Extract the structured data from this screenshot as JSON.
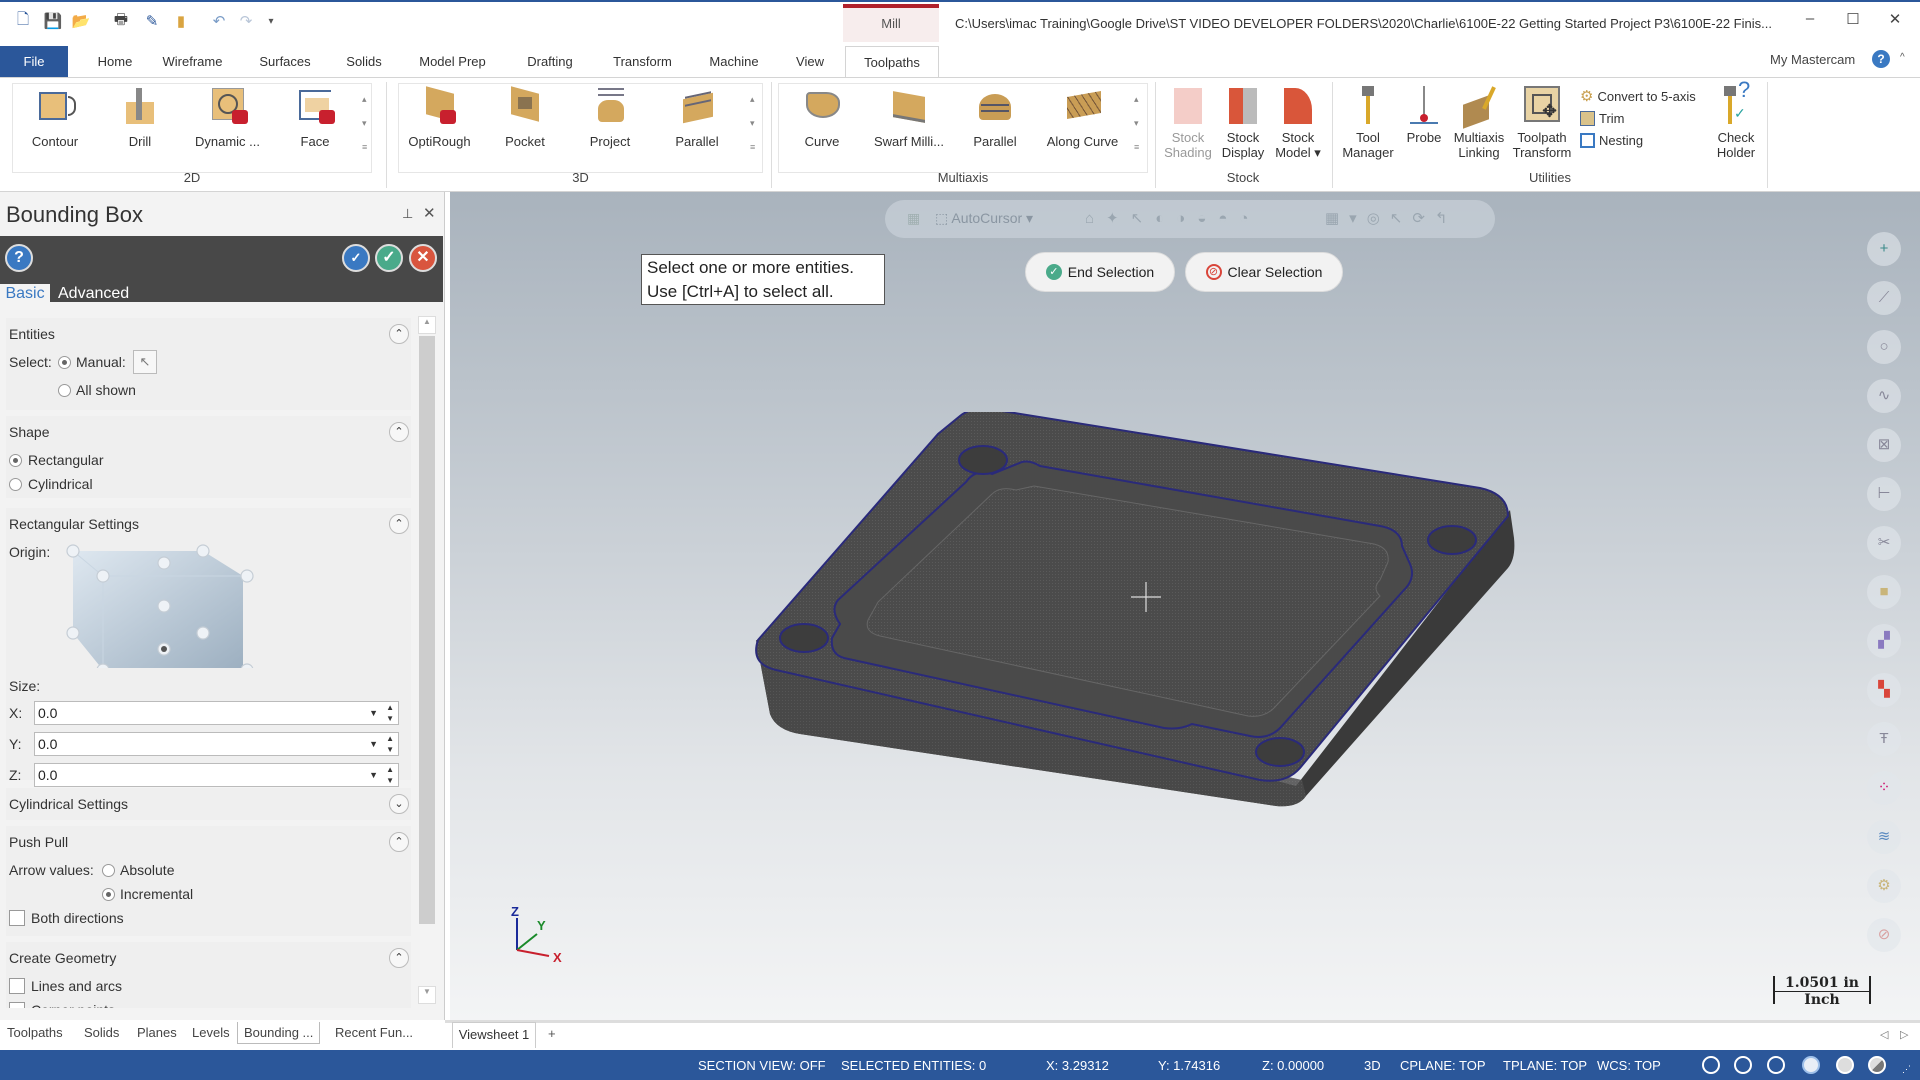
{
  "titlebar": {
    "quick_access": [
      "new-file-icon",
      "save-icon",
      "open-folder-icon",
      "print-icon",
      "save-as-icon",
      "file-manager-icon",
      "undo-icon",
      "redo-icon",
      "customize-icon"
    ],
    "context_tab": "Mill",
    "path": "C:\\Users\\imac Training\\Google Drive\\ST VIDEO DEVELOPER FOLDERS\\2020\\Charlie\\6100E-22 Getting Started Project P3\\6100E-22 Finis...",
    "window_controls": {
      "minimize": "–",
      "maximize": "☐",
      "close": "✕"
    }
  },
  "ribbon_tabs": [
    "File",
    "Home",
    "Wireframe",
    "Surfaces",
    "Solids",
    "Model Prep",
    "Drafting",
    "Transform",
    "Machine",
    "View",
    "Toolpaths"
  ],
  "active_ribbon_tab": "Toolpaths",
  "my_mastercam": "My Mastercam",
  "ribbon": {
    "groups": {
      "g2d": {
        "label": "2D",
        "buttons": [
          "Contour",
          "Drill",
          "Dynamic ...",
          "Face"
        ]
      },
      "g3d": {
        "label": "3D",
        "buttons": [
          "OptiRough",
          "Pocket",
          "Project",
          "Parallel"
        ]
      },
      "multiaxis": {
        "label": "Multiaxis",
        "buttons": [
          "Curve",
          "Swarf Milli...",
          "Parallel",
          "Along Curve"
        ]
      },
      "stock": {
        "label": "Stock",
        "buttons": [
          [
            "Stock",
            "Shading"
          ],
          [
            "Stock",
            "Display"
          ],
          [
            "Stock",
            "Model ▾"
          ]
        ]
      },
      "utilities": {
        "label": "Utilities",
        "buttons": [
          [
            "Tool",
            "Manager"
          ],
          [
            "Probe",
            ""
          ],
          [
            "Multiaxis",
            "Linking"
          ],
          [
            "Toolpath",
            "Transform"
          ]
        ],
        "small": [
          "Convert to 5-axis",
          "Trim",
          "Nesting"
        ],
        "check": [
          "Check",
          "Holder"
        ]
      }
    }
  },
  "panel": {
    "title": "Bounding Box",
    "tabs": {
      "basic": "Basic",
      "advanced": "Advanced"
    },
    "entities": {
      "header": "Entities",
      "select_label": "Select:",
      "manual": "Manual:",
      "all_shown": "All shown",
      "selected": "manual"
    },
    "shape": {
      "header": "Shape",
      "rectangular": "Rectangular",
      "cylindrical": "Cylindrical",
      "selected": "rectangular"
    },
    "rect_settings": {
      "header": "Rectangular Settings",
      "origin_label": "Origin:",
      "size_label": "Size:",
      "x_label": "X:",
      "y_label": "Y:",
      "z_label": "Z:",
      "x": "0.0",
      "y": "0.0",
      "z": "0.0"
    },
    "cyl_settings": {
      "header": "Cylindrical Settings"
    },
    "push_pull": {
      "header": "Push Pull",
      "arrow_label": "Arrow values:",
      "absolute": "Absolute",
      "incremental": "Incremental",
      "selected": "incremental",
      "both_directions": "Both directions",
      "both_checked": false
    },
    "create_geometry": {
      "header": "Create Geometry",
      "lines_arcs": "Lines and arcs",
      "corner_points": "Corner points"
    }
  },
  "bottom_tabs": [
    "Toolpaths",
    "Solids",
    "Planes",
    "Levels",
    "Bounding ...",
    "Recent Fun..."
  ],
  "active_bottom_tab": "Bounding ...",
  "viewsheet": {
    "tab": "Viewsheet 1",
    "add": "+"
  },
  "viewport": {
    "selection_toolbar": {
      "autocursor": "AutoCursor"
    },
    "prompt": [
      "Select one or more entities.",
      "Use [Ctrl+A] to select all."
    ],
    "end_selection": "End Selection",
    "clear_selection": "Clear Selection",
    "axes": {
      "x": "X",
      "y": "Y",
      "z": "Z"
    },
    "scale": {
      "value": "1.0501 in",
      "unit": "Inch"
    }
  },
  "statusbar": {
    "section_view": "SECTION VIEW: OFF",
    "selected_entities": "SELECTED ENTITIES: 0",
    "x": "X:  3.29312",
    "y": "Y:  1.74316",
    "z": "Z:  0.00000",
    "mode": "3D",
    "cplane": "CPLANE: TOP",
    "tplane": "TPLANE: TOP",
    "wcs": "WCS: TOP"
  },
  "colors": {
    "brand_blue": "#2b579a",
    "mill_red": "#b0212b",
    "panel_dark": "#484848",
    "part_gray": "#4a4a4a",
    "edge_blue": "#2a2a7a"
  }
}
